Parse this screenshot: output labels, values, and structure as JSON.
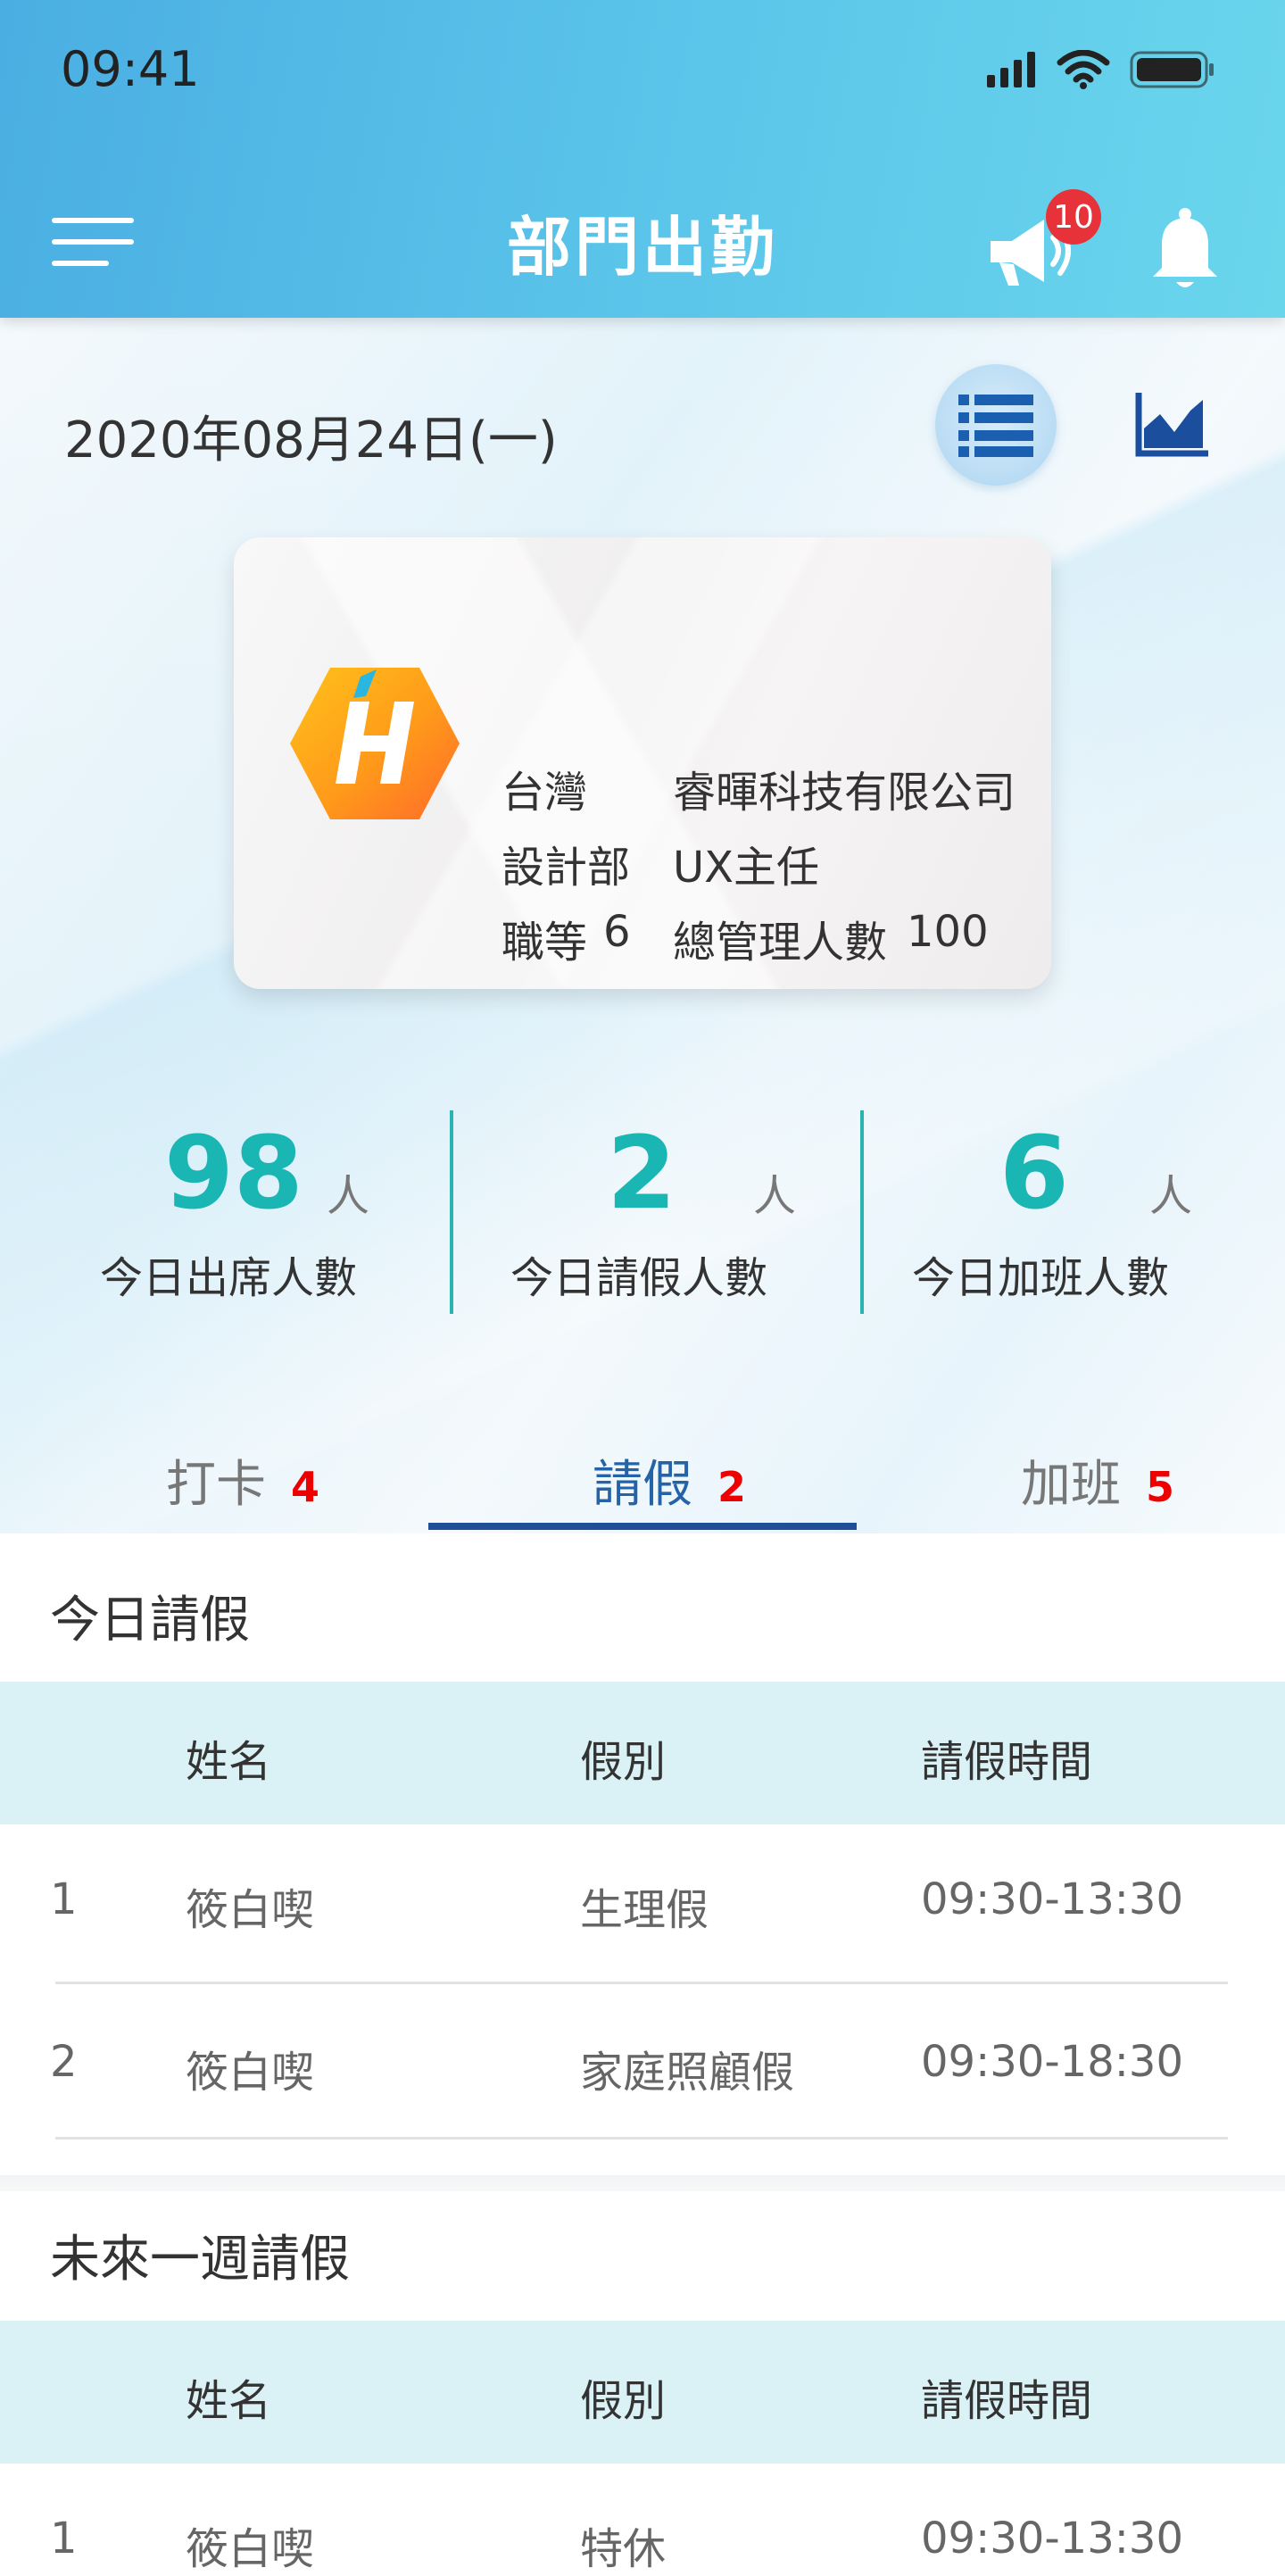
{
  "status_bar": {
    "time": "09:41"
  },
  "header": {
    "title": "部門出勤",
    "notification_badge": "10"
  },
  "date_row": {
    "date": "2020年08月24日(一)"
  },
  "card": {
    "region": "台灣",
    "company": "睿暉科技有限公司",
    "department": "設計部",
    "position": "UX主任",
    "grade_label": "職等",
    "grade_value": "6",
    "managed_label": "總管理人數",
    "managed_value": "100"
  },
  "stats": [
    {
      "number": "98",
      "unit": "人",
      "label": "今日出席人數"
    },
    {
      "number": "2",
      "unit": "人",
      "label": "今日請假人數"
    },
    {
      "number": "6",
      "unit": "人",
      "label": "今日加班人數"
    }
  ],
  "tabs": [
    {
      "label": "打卡",
      "count": "4"
    },
    {
      "label": "請假",
      "count": "2"
    },
    {
      "label": "加班",
      "count": "5"
    }
  ],
  "today_leave": {
    "title": "今日請假",
    "columns": [
      "姓名",
      "假別",
      "請假時間"
    ],
    "rows": [
      {
        "index": "1",
        "name": "筱白喫",
        "type": "生理假",
        "time": "09:30-13:30"
      },
      {
        "index": "2",
        "name": "筱白喫",
        "type": "家庭照顧假",
        "time": "09:30-18:30"
      }
    ]
  },
  "week_leave": {
    "title": "未來一週請假",
    "columns": [
      "姓名",
      "假別",
      "請假時間"
    ],
    "rows": [
      {
        "index": "1",
        "name": "筱白喫",
        "type": "特休",
        "time": "09:30-13:30"
      }
    ]
  },
  "colors": {
    "header_start": "#4aaee2",
    "header_end": "#6ad6ec",
    "stat_teal": "#1ab6b4",
    "active_tab": "#2563a8",
    "tab_count_red": "#ee0000",
    "table_header_bg": "#daf1f5"
  },
  "icons": [
    "menu-icon",
    "megaphone-icon",
    "bell-icon",
    "list-view-icon",
    "area-chart-icon",
    "company-logo"
  ]
}
